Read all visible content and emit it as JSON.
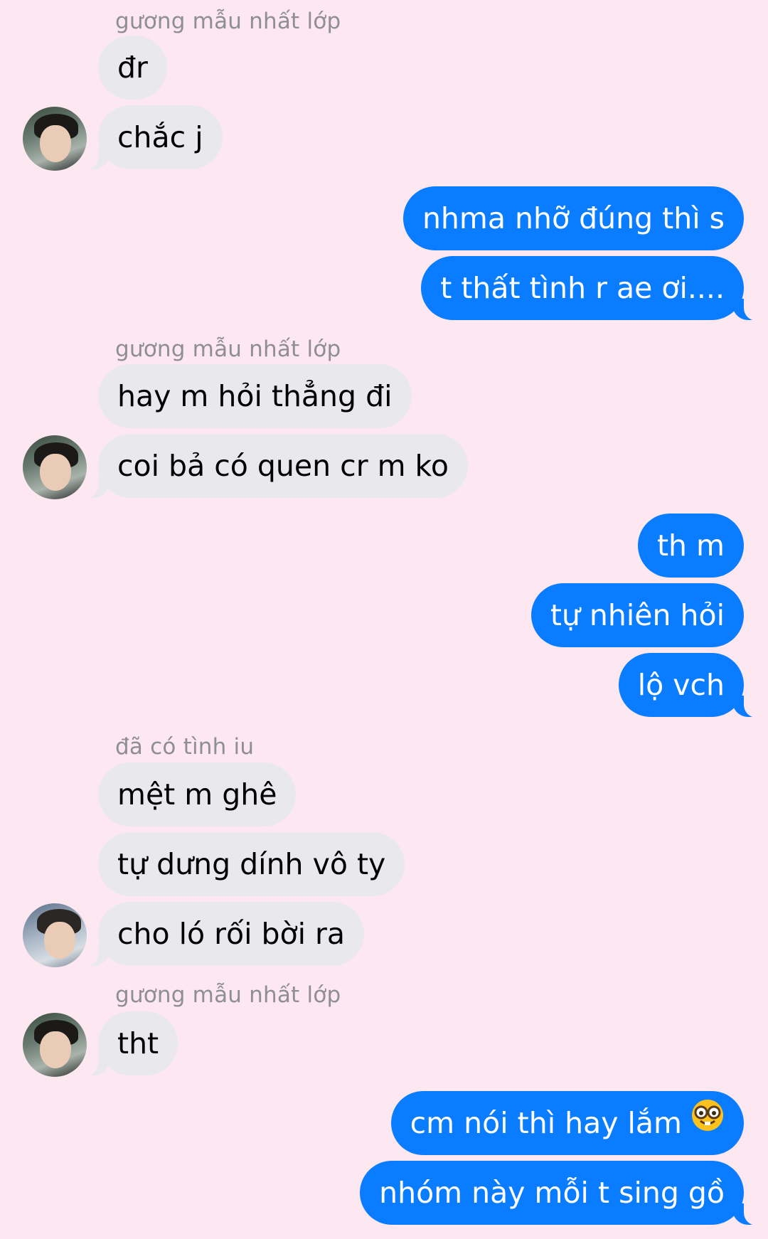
{
  "senders": {
    "s1": "gương mẫu nhất lớp",
    "s2": "gương mẫu nhất lớp",
    "s3": "đã có tình iu",
    "s4": "gương mẫu nhất lớp"
  },
  "messages": {
    "m1": "đr",
    "m2": "chắc j",
    "m3": "nhma nhỡ đúng thì s",
    "m4": "t thất tình r ae ơi....",
    "m5": "hay m hỏi thẳng đi",
    "m6": "coi bả có quen cr m ko",
    "m7": "th m",
    "m8": "tự nhiên hỏi",
    "m9": "lộ vch",
    "m10": "mệt m ghê",
    "m11": "tự dưng dính vô ty",
    "m12": "cho ló rối bời ra",
    "m13": "tht",
    "m14": "cm nói thì hay lắm",
    "m15": "nhóm này mỗi t sing gồ"
  },
  "icons": {
    "nerd_emoji": "nerd-face-emoji",
    "avatar_a": "avatar-photo-boy",
    "avatar_b": "avatar-photo-boy-thumbs-up"
  },
  "colors": {
    "background": "#fde8f1",
    "incoming_bubble": "#e8e8ed",
    "outgoing_bubble": "#0a7cff"
  }
}
